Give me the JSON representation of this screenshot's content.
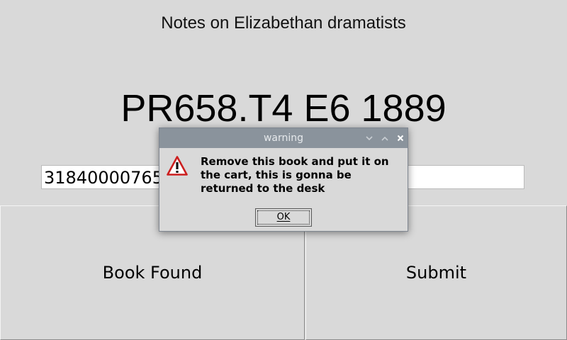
{
  "book": {
    "title": "Notes on Elizabethan dramatists",
    "call_number": "PR658.T4 E6 1889"
  },
  "barcode_input": {
    "value": "31840000765"
  },
  "buttons": {
    "book_found": "Book Found",
    "submit": "Submit"
  },
  "dialog": {
    "title": "warning",
    "message": "Remove this book and put it on the cart, this is gonna be returned to the desk",
    "ok_label": "OK",
    "icon": "warning-triangle-icon"
  },
  "colors": {
    "background": "#d9d9d9",
    "titlebar": "#8a939c",
    "warning_red": "#cc1f1f"
  }
}
